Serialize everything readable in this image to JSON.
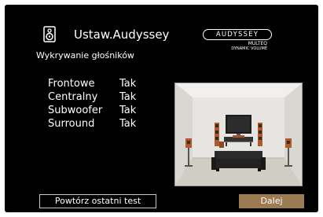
{
  "header": {
    "title": "Ustaw.Audyssey",
    "subtitle": "Wykrywanie głośników",
    "icon": "speaker-icon"
  },
  "logo": {
    "brand": "AUDYSSEY",
    "line1": "MULTEQ",
    "line2": "DYNAMIC VOLUME"
  },
  "speakers": [
    {
      "name": "Frontowe",
      "status": "Tak"
    },
    {
      "name": "Centralny",
      "status": "Tak"
    },
    {
      "name": "Subwoofer",
      "status": "Tak"
    },
    {
      "name": "Surround",
      "status": "Tak"
    }
  ],
  "buttons": {
    "repeat": "Powtórz ostatni test",
    "next": "Dalej"
  },
  "colors": {
    "background": "#000000",
    "accent": "#9c7a52",
    "text": "#ffffff"
  }
}
